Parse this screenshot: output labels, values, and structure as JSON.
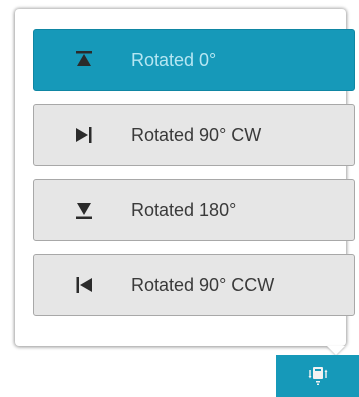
{
  "rotation_menu": {
    "options": [
      {
        "label": "Rotated 0°",
        "icon": "rotate-0-icon",
        "selected": true
      },
      {
        "label": "Rotated 90° CW",
        "icon": "rotate-90-cw-icon",
        "selected": false
      },
      {
        "label": "Rotated 180°",
        "icon": "rotate-180-icon",
        "selected": false
      },
      {
        "label": "Rotated 90° CCW",
        "icon": "rotate-90-ccw-icon",
        "selected": false
      }
    ]
  },
  "toggle_button": {
    "icon": "rotation-menu-icon"
  },
  "colors": {
    "accent": "#1699b9",
    "option_bg": "#e6e6e6",
    "option_border": "#a8a8a8",
    "text": "#3a3a3a",
    "selected_text": "#b5e6f2"
  }
}
